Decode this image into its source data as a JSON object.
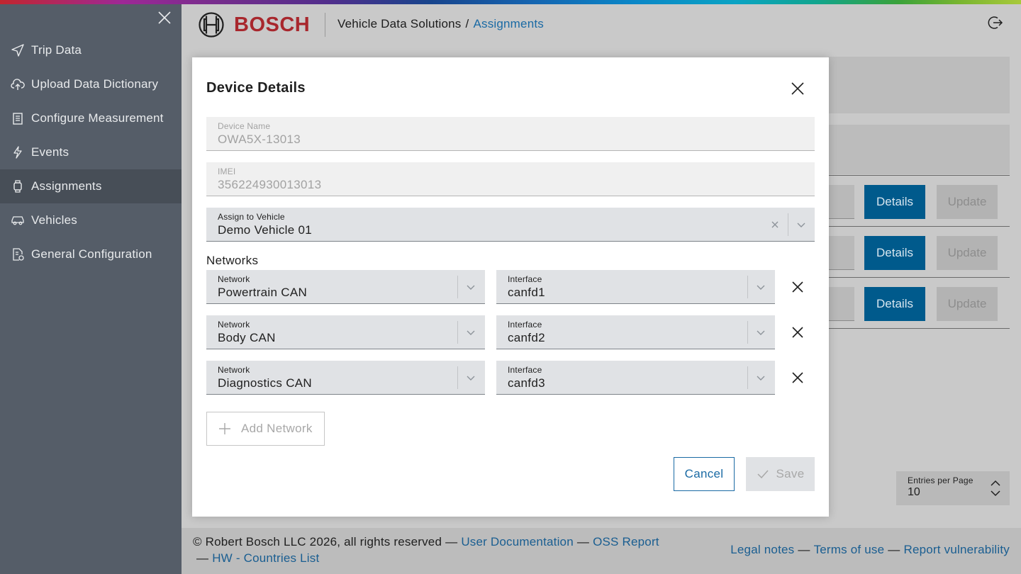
{
  "sidebar": {
    "close_icon": "close-icon",
    "items": [
      {
        "label": "Trip Data",
        "icon": "send-icon",
        "active": false
      },
      {
        "label": "Upload Data Dictionary",
        "icon": "cloud-upload-icon",
        "active": false
      },
      {
        "label": "Configure Measurement",
        "icon": "clipboard-list-icon",
        "active": false
      },
      {
        "label": "Events",
        "icon": "lightning-icon",
        "active": false
      },
      {
        "label": "Assignments",
        "icon": "device-watch-icon",
        "active": true
      },
      {
        "label": "Vehicles",
        "icon": "car-icon",
        "active": false
      },
      {
        "label": "General Configuration",
        "icon": "settings-document-icon",
        "active": false
      }
    ]
  },
  "header": {
    "brand": "BOSCH",
    "breadcrumb_root": "Vehicle Data Solutions",
    "breadcrumb_sep": "/",
    "breadcrumb_current": "Assignments",
    "logout_icon": "logout-icon"
  },
  "background": {
    "rows": [
      {
        "details_label": "Details",
        "update_label": "Update"
      },
      {
        "details_label": "Details",
        "update_label": "Update"
      },
      {
        "details_label": "Details",
        "update_label": "Update"
      }
    ],
    "entries_per_page": {
      "label": "Entries per Page",
      "value": "10"
    }
  },
  "modal": {
    "title": "Device Details",
    "device_name": {
      "label": "Device Name",
      "value": "OWA5X-13013"
    },
    "imei": {
      "label": "IMEI",
      "value": "356224930013013"
    },
    "assign_vehicle": {
      "label": "Assign to Vehicle",
      "value": "Demo Vehicle 01"
    },
    "networks_title": "Networks",
    "networks": [
      {
        "network_label": "Network",
        "network_value": "Powertrain CAN",
        "interface_label": "Interface",
        "interface_value": "canfd1"
      },
      {
        "network_label": "Network",
        "network_value": "Body CAN",
        "interface_label": "Interface",
        "interface_value": "canfd2"
      },
      {
        "network_label": "Network",
        "network_value": "Diagnostics CAN",
        "interface_label": "Interface",
        "interface_value": "canfd3"
      }
    ],
    "add_network_label": "Add Network",
    "cancel_label": "Cancel",
    "save_label": "Save"
  },
  "footer": {
    "copyright": "© Robert Bosch LLC 2026, all rights reserved",
    "dash": "—",
    "user_documentation": "User Documentation",
    "oss_report": "OSS Report",
    "hw_countries": "HW - Countries List",
    "legal_notes": "Legal notes",
    "terms_of_use": "Terms of use",
    "report_vulnerability": "Report vulnerability"
  },
  "colors": {
    "brand_red": "#a8272d",
    "primary_blue": "#005a8c",
    "link_blue": "#1a6aa4",
    "sidebar_bg": "#555d68"
  }
}
